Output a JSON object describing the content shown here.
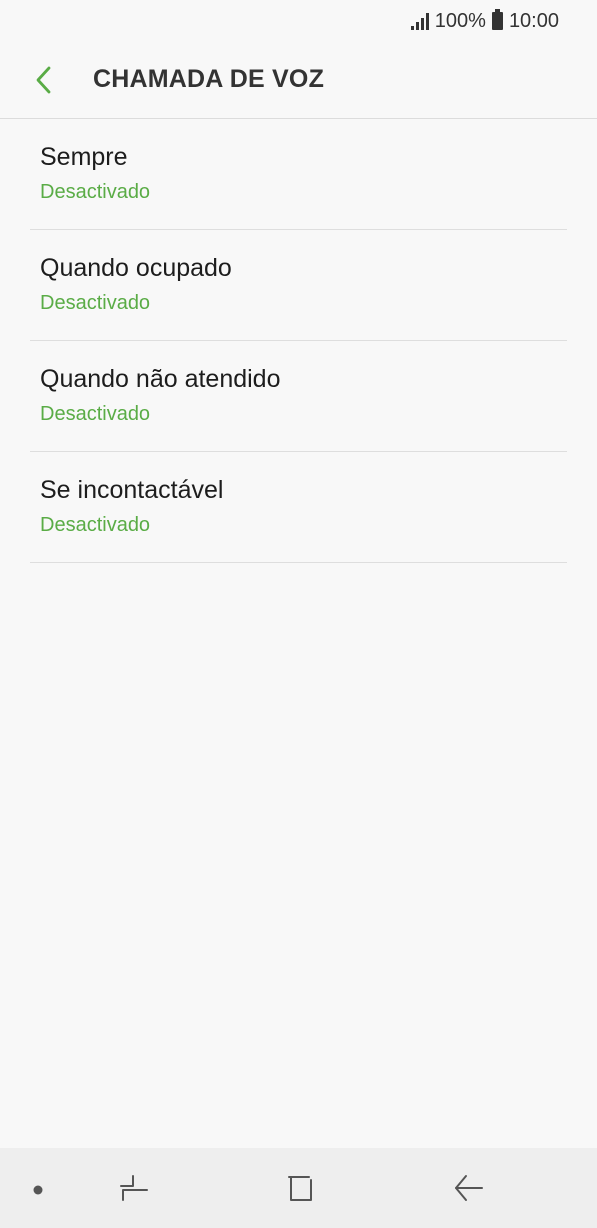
{
  "status_bar": {
    "battery": "100%",
    "time": "10:00",
    "icons": [
      "signal-icon",
      "battery-icon"
    ]
  },
  "header": {
    "title": "CHAMADA DE VOZ",
    "back_icon": "back-arrow-icon",
    "accent_color": "#5aac46"
  },
  "items": [
    {
      "title": "Sempre",
      "status": "Desactivado"
    },
    {
      "title": "Quando ocupado",
      "status": "Desactivado"
    },
    {
      "title": "Quando não atendido",
      "status": "Desactivado"
    },
    {
      "title": "Se incontactável",
      "status": "Desactivado"
    }
  ],
  "nav_bar": {
    "icons": [
      "dot-icon",
      "recent-apps-icon",
      "home-icon",
      "back-icon"
    ]
  }
}
